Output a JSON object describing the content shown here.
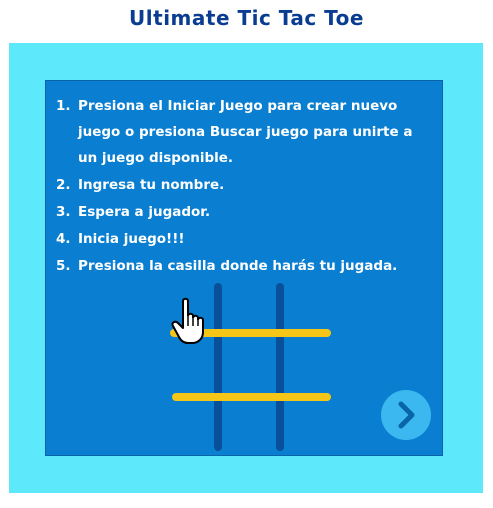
{
  "header": {
    "title": "Ultimate Tic Tac Toe"
  },
  "instructions": {
    "steps": [
      {
        "num": "1.",
        "text": "Presiona el Iniciar Juego para crear nuevo juego o presiona Buscar juego para unirte a un juego disponible."
      },
      {
        "num": "2.",
        "text": "Ingresa tu nombre."
      },
      {
        "num": "3.",
        "text": "Espera a jugador."
      },
      {
        "num": "4.",
        "text": "Inicia juego!!!"
      },
      {
        "num": "5.",
        "text": "Presiona la casilla donde harás tu jugada."
      }
    ]
  },
  "illustration": {
    "icon": "pointer-hand-icon",
    "line_vertical_color": "#0a4f99",
    "line_horizontal_color": "#f5c518"
  },
  "navigation": {
    "next_icon": "chevron-right-icon"
  },
  "colors": {
    "title": "#0a3d91",
    "outer_panel": "#5de8fb",
    "inner_panel": "#0a7fd1",
    "button": "#3bb8f0",
    "button_chevron": "#0a64a8"
  }
}
